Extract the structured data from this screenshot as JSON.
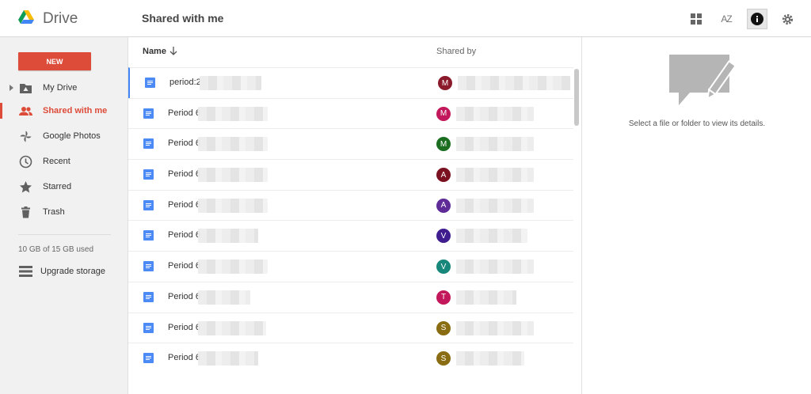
{
  "app": {
    "name": "Drive",
    "page_title": "Shared with me"
  },
  "toolbar": {
    "grid_icon": "grid-view-icon",
    "sort_label": "AZ",
    "info_icon": "info-icon",
    "settings_icon": "gear-icon"
  },
  "sidebar": {
    "new_label": "NEW",
    "items": [
      {
        "label": "My Drive",
        "icon": "my-drive-icon"
      },
      {
        "label": "Shared with me",
        "icon": "shared-people-icon",
        "active": true
      },
      {
        "label": "Google Photos",
        "icon": "photos-pinwheel-icon"
      },
      {
        "label": "Recent",
        "icon": "clock-icon"
      },
      {
        "label": "Starred",
        "icon": "star-icon"
      },
      {
        "label": "Trash",
        "icon": "trash-icon"
      }
    ],
    "storage": "10 GB of 15 GB used",
    "upgrade": "Upgrade storage"
  },
  "table": {
    "col_name": "Name",
    "col_shared_by": "Shared by",
    "rows": [
      {
        "name": "period:2",
        "avatar": "M",
        "color": "#8b1a2b"
      },
      {
        "name": "Period 6",
        "avatar": "M",
        "color": "#c2185b"
      },
      {
        "name": "Period 6",
        "avatar": "M",
        "color": "#1b6e20"
      },
      {
        "name": "Period 6",
        "avatar": "A",
        "color": "#7b1020"
      },
      {
        "name": "Period 6",
        "avatar": "A",
        "color": "#5e2b97"
      },
      {
        "name": "Period 6",
        "avatar": "V",
        "color": "#3f1d8f"
      },
      {
        "name": "Period 6",
        "avatar": "V",
        "color": "#17877b"
      },
      {
        "name": "Period 6",
        "avatar": "T",
        "color": "#c2185b"
      },
      {
        "name": "Period 6",
        "avatar": "S",
        "color": "#8a6d12"
      },
      {
        "name": "Period 6",
        "avatar": "S",
        "color": "#8a6d12"
      }
    ]
  },
  "details": {
    "message": "Select a file or folder to view its details."
  }
}
